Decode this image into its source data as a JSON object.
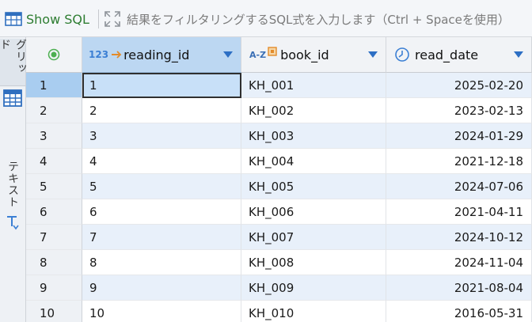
{
  "toolbar": {
    "show_sql_label": "Show SQL",
    "filter_placeholder": "結果をフィルタリングするSQL式を入力します（Ctrl + Spaceを使用）"
  },
  "side_tabs": {
    "grid_label": "グリッド",
    "text_label": "テキスト"
  },
  "columns": [
    {
      "name": "reading_id",
      "type_badge": "123"
    },
    {
      "name": "book_id",
      "type_badge": "A-Z"
    },
    {
      "name": "read_date",
      "type_badge": ""
    }
  ],
  "rows": [
    {
      "num": "1",
      "reading_id": "1",
      "book_id": "KH_001",
      "read_date": "2025-02-20"
    },
    {
      "num": "2",
      "reading_id": "2",
      "book_id": "KH_002",
      "read_date": "2023-02-13"
    },
    {
      "num": "3",
      "reading_id": "3",
      "book_id": "KH_003",
      "read_date": "2024-01-29"
    },
    {
      "num": "4",
      "reading_id": "4",
      "book_id": "KH_004",
      "read_date": "2021-12-18"
    },
    {
      "num": "5",
      "reading_id": "5",
      "book_id": "KH_005",
      "read_date": "2024-07-06"
    },
    {
      "num": "6",
      "reading_id": "6",
      "book_id": "KH_006",
      "read_date": "2021-04-11"
    },
    {
      "num": "7",
      "reading_id": "7",
      "book_id": "KH_007",
      "read_date": "2024-10-12"
    },
    {
      "num": "8",
      "reading_id": "8",
      "book_id": "KH_008",
      "read_date": "2024-11-04"
    },
    {
      "num": "9",
      "reading_id": "9",
      "book_id": "KH_009",
      "read_date": "2021-08-04"
    },
    {
      "num": "10",
      "reading_id": "10",
      "book_id": "KH_010",
      "read_date": "2016-05-31"
    }
  ],
  "icons": {
    "show_sql": "table-sql-icon",
    "expand": "expand-icon",
    "grid_view": "grid-icon",
    "text_view": "text-format-icon",
    "select_all": "select-all-icon",
    "key": "key-icon",
    "clock": "clock-icon",
    "sort": "chevron-down-icon"
  },
  "colors": {
    "accent_green": "#2e7d32",
    "selected_header": "#bcd7f2",
    "alt_row": "#e8f0fa",
    "type_badge": "#3b7fd4",
    "sort_arrow": "#2d6fc4"
  }
}
